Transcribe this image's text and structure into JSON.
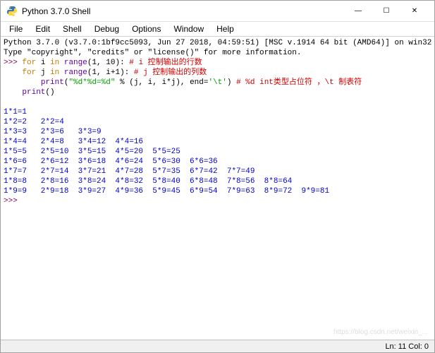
{
  "window": {
    "title": "Python 3.7.0 Shell",
    "buttons": {
      "min": "—",
      "max": "☐",
      "close": "✕"
    }
  },
  "menu": {
    "file": "File",
    "edit": "Edit",
    "shell": "Shell",
    "debug": "Debug",
    "options": "Options",
    "window": "Window",
    "help": "Help"
  },
  "shell": {
    "banner1": "Python 3.7.0 (v3.7.0:1bf9cc5093, Jun 27 2018, 04:59:51) [MSC v.1914 64 bit (AMD64)] on win32",
    "banner2": "Type \"copyright\", \"credits\" or \"license()\" for more information.",
    "prompt": ">>> ",
    "for1_a": "for",
    "for1_b": " i ",
    "for1_c": "in",
    "for1_d": " ",
    "for1_e": "range",
    "for1_f": "(1, 10): ",
    "cm1": "# i 控制输出的行数",
    "for2_a": "    ",
    "for2_b": "for",
    "for2_c": " j ",
    "for2_d": "in",
    "for2_e": " ",
    "for2_f": "range",
    "for2_g": "(1, i+1): ",
    "cm2": "# j 控制输出的列数",
    "pr_a": "        ",
    "pr_b": "print",
    "pr_c": "(",
    "pr_d": "\"%d*%d=%d\"",
    "pr_e": " % (j, i, i*j), end=",
    "pr_f": "'\\t'",
    "pr_g": ") ",
    "cm3": "# %d int类型占位符 ，\\t 制表符",
    "pr2_a": "    ",
    "pr2_b": "print",
    "pr2_c": "()",
    "blank": " ",
    "o1": "1*1=1",
    "o2": "1*2=2   2*2=4",
    "o3": "1*3=3   2*3=6   3*3=9",
    "o4": "1*4=4   2*4=8   3*4=12  4*4=16",
    "o5": "1*5=5   2*5=10  3*5=15  4*5=20  5*5=25",
    "o6": "1*6=6   2*6=12  3*6=18  4*6=24  5*6=30  6*6=36",
    "o7": "1*7=7   2*7=14  3*7=21  4*7=28  5*7=35  6*7=42  7*7=49",
    "o8": "1*8=8   2*8=16  3*8=24  4*8=32  5*8=40  6*8=48  7*8=56  8*8=64",
    "o9": "1*9=9   2*9=18  3*9=27  4*9=36  5*9=45  6*9=54  7*9=63  8*9=72  9*9=81"
  },
  "status": {
    "pos": "Ln: 11  Col: 0"
  },
  "watermark": "https://blog.csdn.net/weixin_..."
}
